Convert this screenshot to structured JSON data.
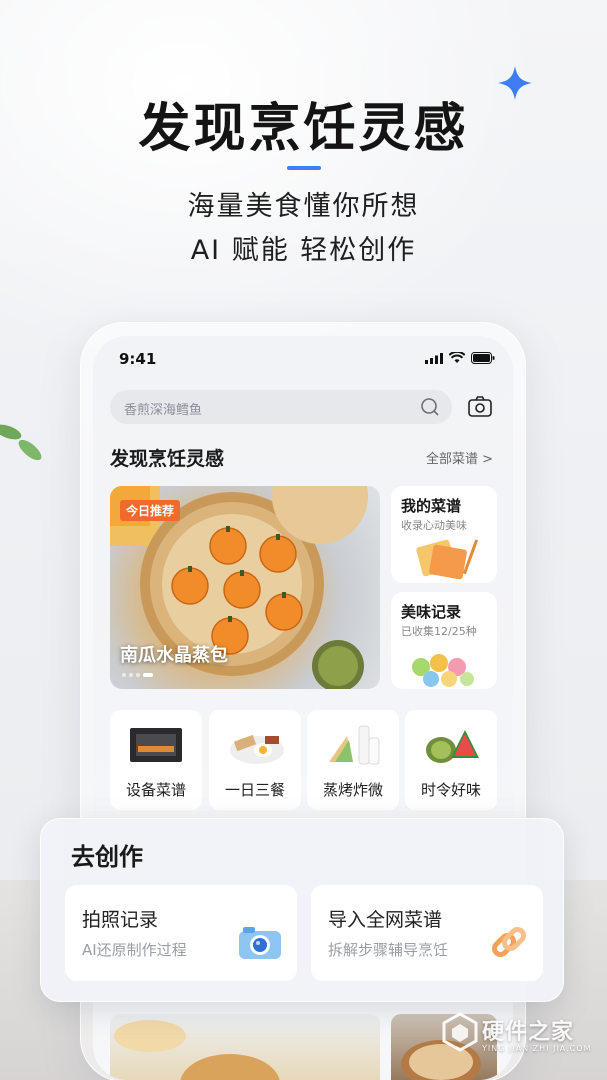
{
  "hero": {
    "title": "发现烹饪灵感",
    "subtitle_line1": "海量美食懂你所想",
    "subtitle_line2": "AI 赋能 轻松创作",
    "accent_color": "#3f7ef2"
  },
  "status_bar": {
    "time": "9:41"
  },
  "search": {
    "placeholder": "香煎深海鳕鱼"
  },
  "section": {
    "title": "发现烹饪灵感",
    "more": "全部菜谱 >"
  },
  "featured": {
    "badge": "今日推荐",
    "name": "南瓜水晶蒸包"
  },
  "side_cards": [
    {
      "title": "我的菜谱",
      "subtitle": "收录心动美味"
    },
    {
      "title": "美味记录",
      "subtitle": "已收集12/25种"
    }
  ],
  "categories": [
    {
      "label": "设备菜谱",
      "icon": "oven-icon"
    },
    {
      "label": "一日三餐",
      "icon": "breakfast-plate-icon"
    },
    {
      "label": "蒸烤炸微",
      "icon": "sandwich-milk-icon"
    },
    {
      "label": "时令好味",
      "icon": "melon-icon"
    }
  ],
  "create": {
    "title": "去创作",
    "cards": [
      {
        "title": "拍照记录",
        "subtitle": "AI还原制作过程",
        "icon": "camera-icon"
      },
      {
        "title": "导入全网菜谱",
        "subtitle": "拆解步骤辅导烹饪",
        "icon": "link-icon"
      }
    ]
  },
  "watermark": {
    "text": "硬件之家",
    "sub": "YING JIAN ZHI JIA.COM"
  }
}
